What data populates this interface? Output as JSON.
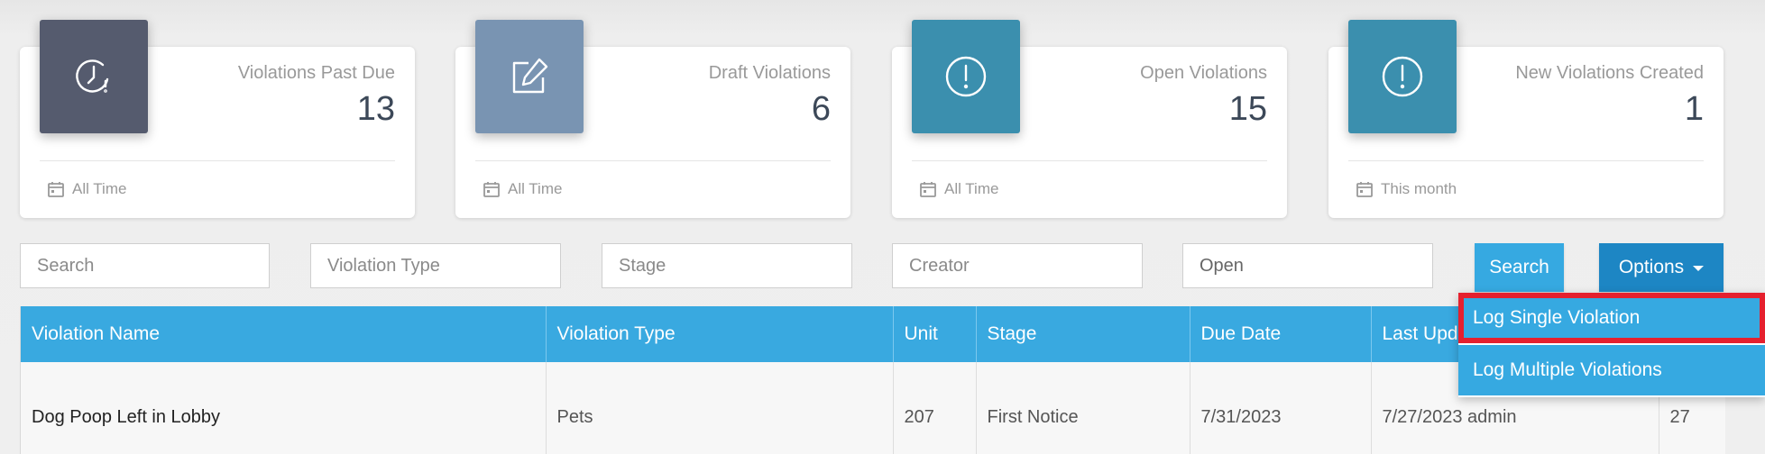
{
  "cards": [
    {
      "title": "Violations Past Due",
      "value": "13",
      "footer": "All Time",
      "icon": "clock-alert-icon",
      "color": "#555b6e"
    },
    {
      "title": "Draft Violations",
      "value": "6",
      "footer": "All Time",
      "icon": "edit-icon",
      "color": "#7994b2"
    },
    {
      "title": "Open Violations",
      "value": "15",
      "footer": "All Time",
      "icon": "alert-circle-icon",
      "color": "#3b8fae"
    },
    {
      "title": "New Violations Created",
      "value": "1",
      "footer": "This month",
      "icon": "alert-circle-icon",
      "color": "#3b8fae"
    }
  ],
  "filters": {
    "search_placeholder": "Search",
    "violation_type_placeholder": "Violation Type",
    "stage_placeholder": "Stage",
    "creator_placeholder": "Creator",
    "status_value": "Open"
  },
  "buttons": {
    "search_label": "Search",
    "options_label": "Options"
  },
  "dropdown": {
    "items": [
      {
        "label": "Log Single Violation"
      },
      {
        "label": "Log Multiple Violations"
      }
    ]
  },
  "table": {
    "headers": [
      "Violation Name",
      "Violation Type",
      "Unit",
      "Stage",
      "Due Date",
      "Last Updated",
      ""
    ],
    "rows": [
      {
        "name": "Dog Poop Left in Lobby",
        "type": "Pets",
        "unit": "207",
        "stage": "First Notice",
        "due": "7/31/2023",
        "updated": "7/27/2023 admin",
        "extra": "27"
      }
    ]
  },
  "colors": {
    "accent": "#36a9e1",
    "options_button": "#1d86c4",
    "highlight": "#e5202e"
  }
}
